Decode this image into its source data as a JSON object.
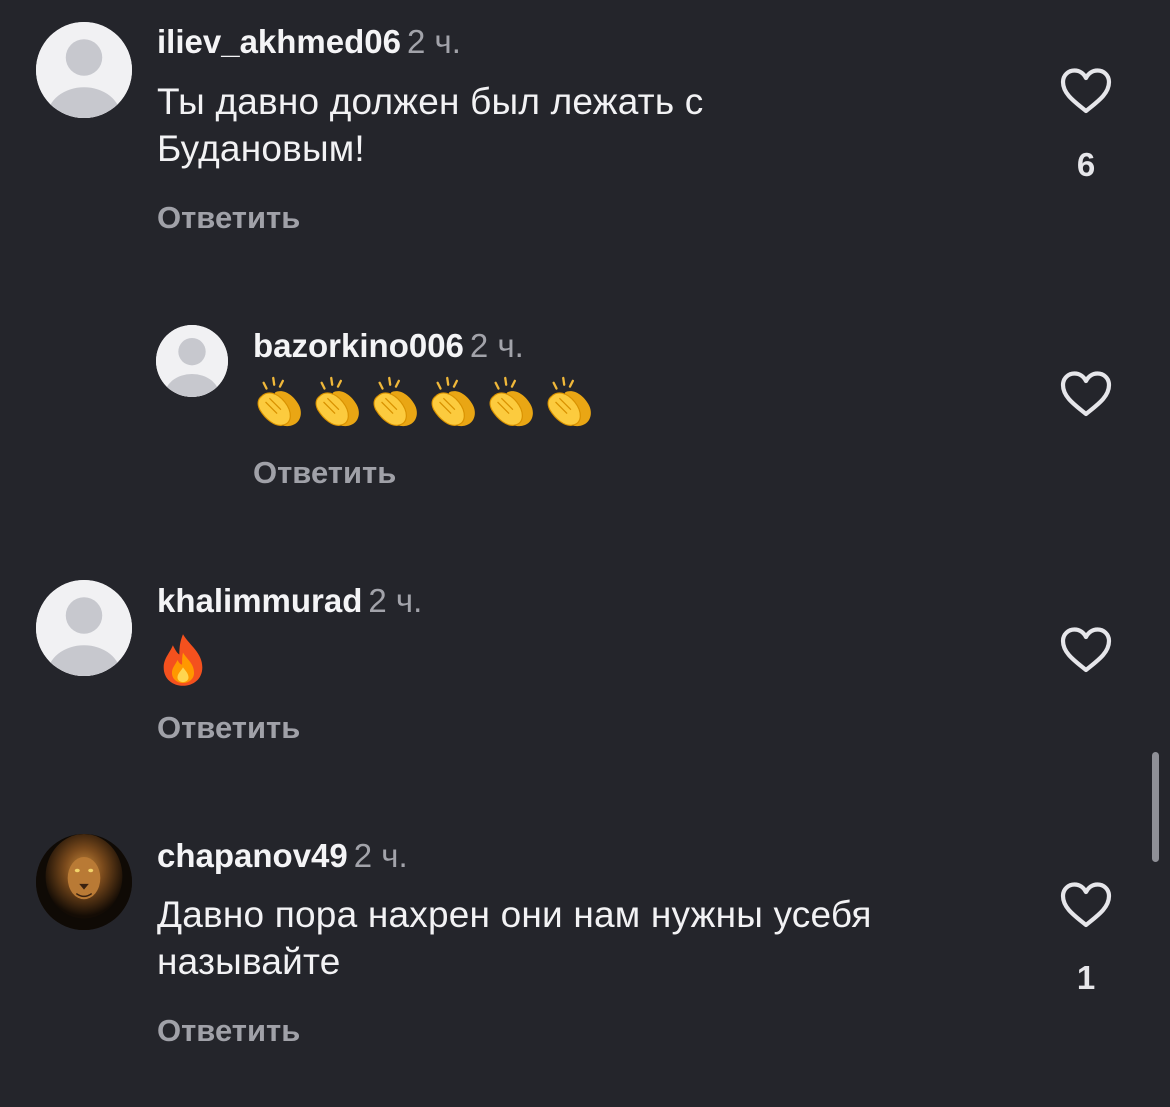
{
  "comments": [
    {
      "username": "iliev_akhmed06",
      "time": "2 ч.",
      "text": "Ты давно должен был лежать с Будановым!",
      "reply_label": "Ответить",
      "like_count": "6",
      "avatar": "default-avatar-icon"
    },
    {
      "username": "bazorkino006",
      "time": "2 ч.",
      "emoji": [
        "👏",
        "👏",
        "👏",
        "👏",
        "👏",
        "👏"
      ],
      "reply_label": "Ответить",
      "like_count": "",
      "avatar": "default-avatar-icon"
    },
    {
      "username": "khalimmurad",
      "time": "2 ч.",
      "emoji": [
        "🔥"
      ],
      "reply_label": "Ответить",
      "like_count": "",
      "avatar": "default-avatar-icon"
    },
    {
      "username": "chapanov49",
      "time": "2 ч.",
      "text": "Давно пора нахрен они нам нужны усебя называйте",
      "reply_label": "Ответить",
      "like_count": "1",
      "avatar": "lion-avatar"
    }
  ],
  "colors": {
    "background": "#24252b",
    "secondary_text": "#a0a1a8",
    "heart_outline": "#e6e6ea"
  }
}
